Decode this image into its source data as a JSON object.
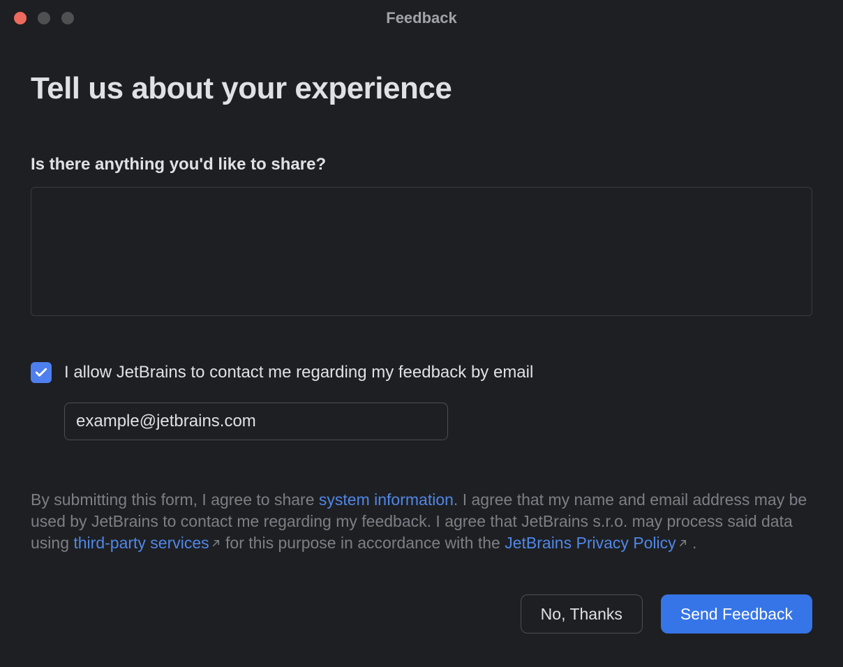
{
  "window": {
    "title": "Feedback"
  },
  "form": {
    "heading": "Tell us about your experience",
    "feedback_label": "Is there anything you'd like to share?",
    "feedback_value": "",
    "consent": {
      "checked": true,
      "label": "I allow JetBrains to contact me regarding my feedback by email"
    },
    "email": {
      "value": "example@jetbrains.com"
    },
    "legal": {
      "pre_link1": "By submitting this form, I agree to share ",
      "link1": "system information",
      "post_link1": ". I agree that my name and email address may be used by JetBrains to contact me regarding my feedback. I agree that JetBrains s.r.o. may process said data using ",
      "link2": "third-party services",
      "post_link2": "  for this purpose in accordance with the ",
      "link3": "JetBrains Privacy Policy",
      "post_link3": " ."
    }
  },
  "buttons": {
    "cancel": "No, Thanks",
    "submit": "Send Feedback"
  }
}
